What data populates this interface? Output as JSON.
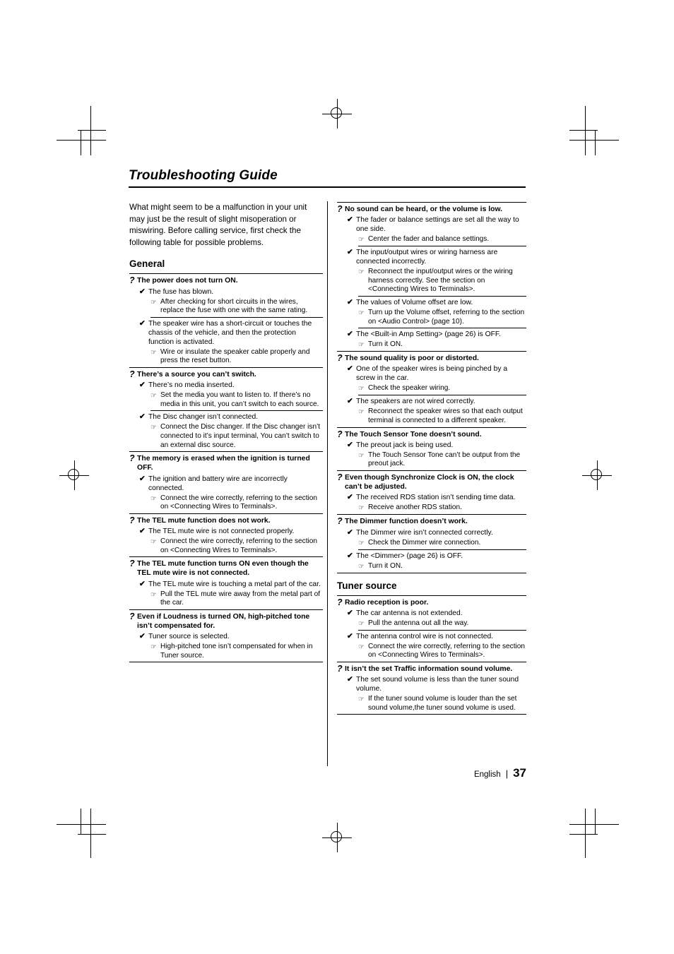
{
  "doc": {
    "title": "Troubleshooting Guide",
    "intro": "What might seem to be a malfunction in your unit may just be the result of slight misoperation or miswiring. Before calling service, first check the following table for possible problems.",
    "footer": {
      "language": "English",
      "separator": "|",
      "page_number": "37"
    }
  },
  "symbols": {
    "question": "?",
    "check": "✔",
    "solution": "☞"
  },
  "left_column": {
    "section_title": "General",
    "entries": [
      {
        "question": "The power does not turn ON.",
        "causes": [
          {
            "text": "The fuse has blown.",
            "solutions": [
              "After checking for short circuits in the wires, replace the fuse with one with the same rating."
            ],
            "rule_after": true
          },
          {
            "text": "The speaker wire has a short-circuit or touches the chassis of the vehicle, and then the protection function is activated.",
            "solutions": [
              "Wire or insulate the speaker cable properly and press the reset button."
            ],
            "rule_after": false
          }
        ]
      },
      {
        "question": "There’s a source you can’t switch.",
        "causes": [
          {
            "text": "There’s no media inserted.",
            "solutions": [
              "Set the media you want to listen to. If there’s no media in this unit, you can’t switch to each source."
            ],
            "rule_after": true
          },
          {
            "text": "The Disc changer isn’t connected.",
            "solutions": [
              "Connect the Disc changer. If the Disc changer isn’t connected to it’s input terminal, You can’t switch to an external disc source."
            ],
            "rule_after": false
          }
        ]
      },
      {
        "question": "The memory is erased when the ignition is turned OFF.",
        "causes": [
          {
            "text": "The ignition and battery wire are incorrectly connected.",
            "solutions": [
              "Connect the wire correctly, referring to the section on <Connecting Wires to Terminals>."
            ],
            "rule_after": false
          }
        ]
      },
      {
        "question": "The TEL mute function does not work.",
        "causes": [
          {
            "text": "The TEL mute wire is not connected properly.",
            "solutions": [
              "Connect the wire correctly, referring to the section on <Connecting Wires to Terminals>."
            ],
            "rule_after": false
          }
        ]
      },
      {
        "question": "The TEL mute function turns ON even though the TEL mute wire is not connected.",
        "causes": [
          {
            "text": "The TEL mute wire is touching a metal part of the car.",
            "solutions": [
              "Pull the TEL mute wire away from the metal part of the car."
            ],
            "rule_after": false
          }
        ]
      },
      {
        "question": "Even if Loudness is turned ON, high-pitched tone isn’t compensated for.",
        "causes": [
          {
            "text": "Tuner source is selected.",
            "solutions": [
              "High-pitched tone isn’t compensated for when in Tuner source."
            ],
            "rule_after": false
          }
        ]
      }
    ]
  },
  "right_column": {
    "entries_top": [
      {
        "question": "No sound can be heard, or the volume is low.",
        "causes": [
          {
            "text": "The fader or balance settings are set all the way to one side.",
            "solutions": [
              "Center the fader and balance settings."
            ],
            "rule_after": true
          },
          {
            "text": "The input/output wires or wiring harness are connected incorrectly.",
            "solutions": [
              "Reconnect the input/output wires or the wiring harness correctly. See the section on <Connecting Wires to Terminals>."
            ],
            "rule_after": true
          },
          {
            "text": "The values of Volume offset are low.",
            "solutions": [
              "Turn up the Volume offset, referring to the section on <Audio Control> (page 10)."
            ],
            "rule_after": true
          },
          {
            "text": "The <Built-in Amp Setting> (page 26) is OFF.",
            "solutions": [
              "Turn it ON."
            ],
            "rule_after": false
          }
        ]
      },
      {
        "question": "The sound quality is poor or distorted.",
        "causes": [
          {
            "text": "One of the speaker wires is being pinched by a screw in the car.",
            "solutions": [
              "Check the speaker wiring."
            ],
            "rule_after": true
          },
          {
            "text": "The speakers are not wired correctly.",
            "solutions": [
              "Reconnect the speaker wires so that each output terminal is connected to a different speaker."
            ],
            "rule_after": false
          }
        ]
      },
      {
        "question": "The Touch Sensor Tone doesn’t sound.",
        "causes": [
          {
            "text": "The preout jack is being used.",
            "solutions": [
              "The Touch Sensor Tone can’t be output from the preout jack."
            ],
            "rule_after": false
          }
        ]
      },
      {
        "question": "Even though Synchronize Clock is ON, the clock can’t be adjusted.",
        "causes": [
          {
            "text": "The received RDS station isn’t sending time data.",
            "solutions": [
              "Receive another RDS station."
            ],
            "rule_after": false
          }
        ]
      },
      {
        "question": "The Dimmer function doesn’t work.",
        "causes": [
          {
            "text": "The Dimmer wire isn’t connected correctly.",
            "solutions": [
              "Check the Dimmer wire connection."
            ],
            "rule_after": true
          },
          {
            "text": "The <Dimmer> (page 26) is OFF.",
            "solutions": [
              "Turn it ON."
            ],
            "rule_after": false
          }
        ]
      }
    ],
    "section_title": "Tuner source",
    "entries_bottom": [
      {
        "question": "Radio reception is poor.",
        "causes": [
          {
            "text": "The car antenna is not extended.",
            "solutions": [
              "Pull the antenna out all the way."
            ],
            "rule_after": true
          },
          {
            "text": "The antenna control wire is not connected.",
            "solutions": [
              "Connect the wire correctly, referring to the section on <Connecting Wires to Terminals>."
            ],
            "rule_after": false
          }
        ]
      },
      {
        "question": "It isn’t the set Traffic information sound volume.",
        "causes": [
          {
            "text": "The set sound volume is less than the tuner sound volume.",
            "solutions": [
              "If the tuner sound volume is louder than the set sound volume,the tuner sound volume is used."
            ],
            "rule_after": false
          }
        ]
      }
    ]
  }
}
